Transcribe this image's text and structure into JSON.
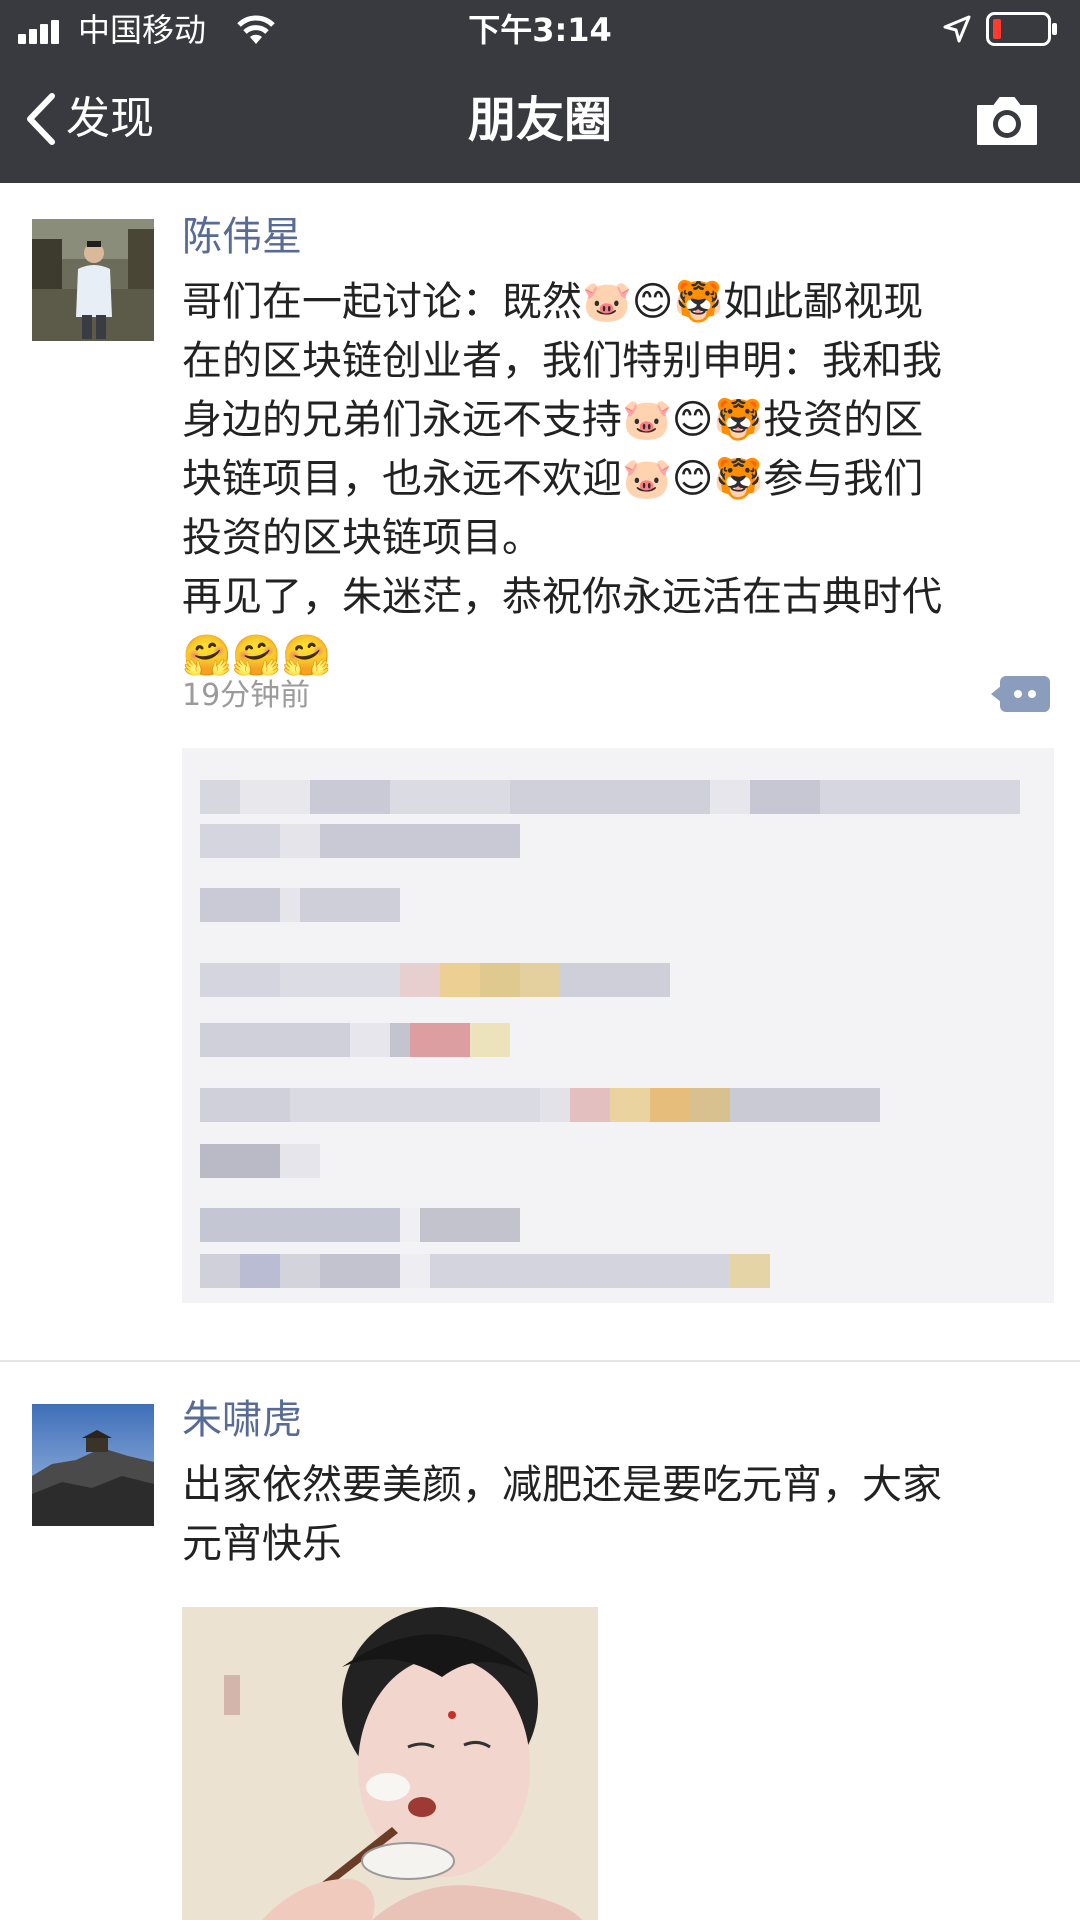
{
  "status_bar": {
    "carrier": "中国移动",
    "time": "下午3:14"
  },
  "nav": {
    "back_label": "发现",
    "title": "朋友圈"
  },
  "posts": [
    {
      "name": "陈伟星",
      "text": "哥们在一起讨论：既然🐷😊🐯如此鄙视现\n在的区块链创业者，我们特别申明：我和我\n身边的兄弟们永远不支持🐷😊🐯投资的区\n块链项目，也永远不欢迎🐷😊🐯参与我们\n投资的区块链项目。\n再见了，朱迷茫，恭祝你永远活在古典时代\n🤗🤗🤗",
      "timestamp": "19分钟前"
    },
    {
      "name": "朱啸虎",
      "text": "出家依然要美颜，减肥还是要吃元宵，大家\n元宵快乐"
    }
  ],
  "colors": {
    "nav_bg": "#393a3f",
    "name_link": "#576b95",
    "comment_bg": "#f3f3f5"
  }
}
